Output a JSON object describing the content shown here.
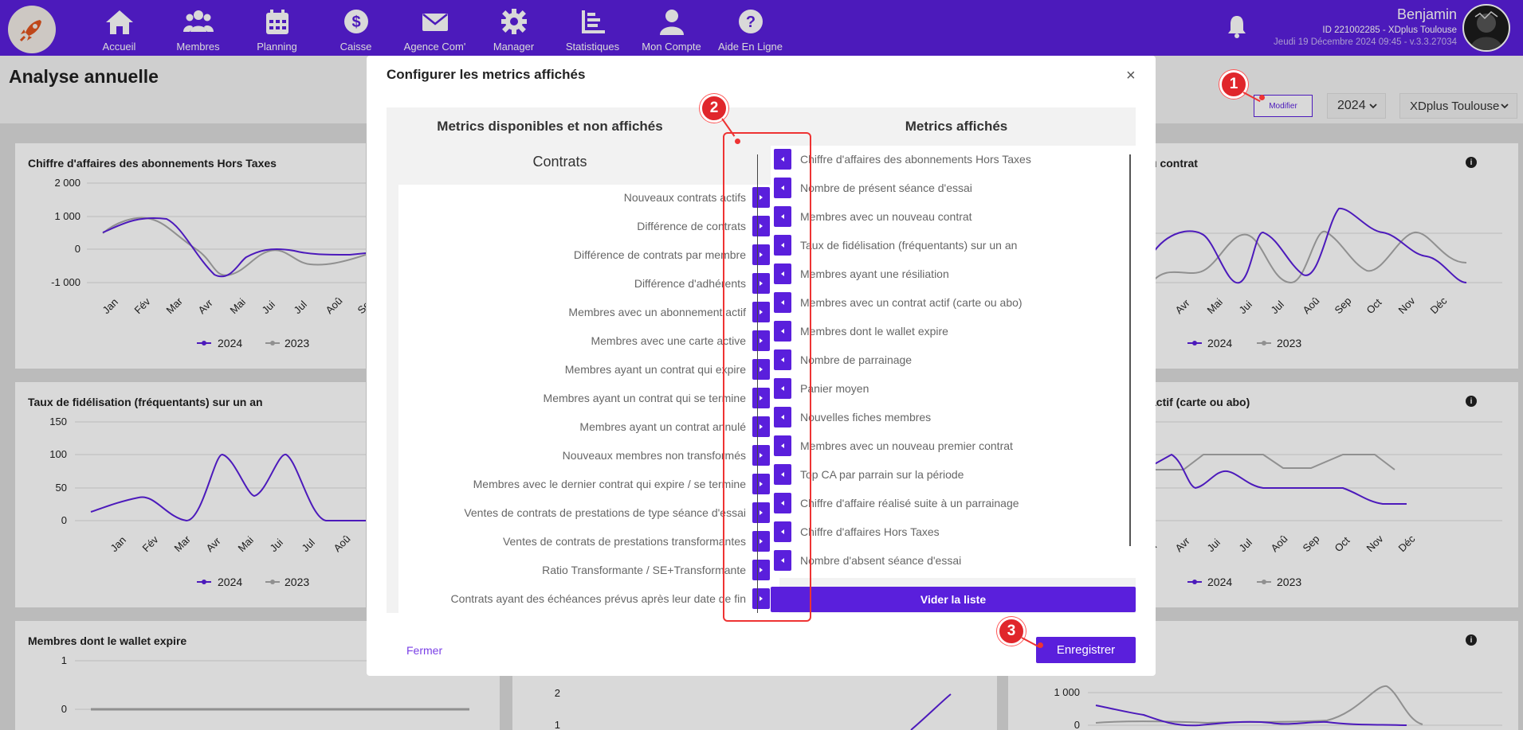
{
  "nav": {
    "items": [
      {
        "label": "Accueil",
        "icon": "home-icon"
      },
      {
        "label": "Membres",
        "icon": "members-icon"
      },
      {
        "label": "Planning",
        "icon": "calendar-icon"
      },
      {
        "label": "Caisse",
        "icon": "dollar-icon"
      },
      {
        "label": "Agence Com'",
        "icon": "envelope-icon"
      },
      {
        "label": "Manager",
        "icon": "gear-icon"
      },
      {
        "label": "Statistiques",
        "icon": "chart-icon"
      },
      {
        "label": "Mon Compte",
        "icon": "user-icon"
      },
      {
        "label": "Aide En Ligne",
        "icon": "help-icon"
      }
    ]
  },
  "user": {
    "name": "Benjamin",
    "id": "ID 221002285 - XDplus Toulouse",
    "date": "Jeudi 19 Décembre 2024 09:45 - v.3.3.27034"
  },
  "page": {
    "title": "Analyse annuelle",
    "modifier_label": "Modifier",
    "year": "2024",
    "club": "XDplus Toulouse"
  },
  "background_cards": {
    "c1_title": "Chiffre d'affaires des abonnements Hors Taxes",
    "c1_y": [
      "2 000",
      "1 000",
      "0",
      "-1 000"
    ],
    "c2_title": "u contrat",
    "c3_title": "Taux de fidélisation (fréquentants) sur un an",
    "c3_y": [
      "150",
      "100",
      "50",
      "0"
    ],
    "c4_title": "actif (carte ou abo)",
    "c5_title": "Membres dont le wallet expire",
    "c5_y": [
      "1",
      "0"
    ],
    "c6_y": [
      "2",
      "1"
    ],
    "c7_y": [
      "1 000",
      "0"
    ],
    "months_left": [
      "Jan",
      "Fév",
      "Mar",
      "Avr",
      "Mai",
      "Jui",
      "Jul",
      "Aoû",
      "Se"
    ],
    "months_right": [
      "Avr",
      "Mai",
      "Jui",
      "Jul",
      "Aoû",
      "Sep",
      "Oct",
      "Nov",
      "Déc"
    ],
    "months_right2": [
      "ar",
      "Avr",
      "Jui",
      "Jul",
      "Aoû",
      "Sep",
      "Oct",
      "Nov",
      "Déc"
    ],
    "legend_2024": "2024",
    "legend_2023": "2023",
    "colors": {
      "series_2024": "#5a1fdc",
      "series_2023": "#aaaaaa"
    }
  },
  "modal": {
    "title": "Configurer les metrics affichés",
    "close": "×",
    "left_header": "Metrics disponibles et non affichés",
    "right_header": "Metrics affichés",
    "group": "Contrats",
    "available": [
      "Nouveaux contrats actifs",
      "Différence de contrats",
      "Différence de contrats par membre",
      "Différence d'adhérents",
      "Membres avec un abonnement actif",
      "Membres avec une carte active",
      "Membres ayant un contrat qui expire",
      "Membres ayant un contrat qui se termine",
      "Membres ayant un contrat annulé",
      "Nouveaux membres non transformés",
      "Membres avec le dernier contrat qui expire / se termine",
      "Ventes de contrats de prestations de type séance d'essai",
      "Ventes de contrats de prestations transformantes",
      "Ratio Transformante / SE+Transformante",
      "Contrats ayant des échéances prévus après leur date de fin"
    ],
    "displayed": [
      "Chiffre d'affaires des abonnements Hors Taxes",
      "Nombre de présent séance d'essai",
      "Membres avec un nouveau contrat",
      "Taux de fidélisation (fréquentants) sur un an",
      "Membres ayant une résiliation",
      "Membres avec un contrat actif (carte ou abo)",
      "Membres dont le wallet expire",
      "Nombre de parrainage",
      "Panier moyen",
      "Nouvelles fiches membres",
      "Membres avec un nouveau premier contrat",
      "Top CA par parrain sur la période",
      "Chiffre d'affaire réalisé suite à un parrainage",
      "Chiffre d'affaires Hors Taxes",
      "Nombre d'absent séance d'essai"
    ],
    "clear_label": "Vider la liste",
    "close_label": "Fermer",
    "save_label": "Enregistrer"
  },
  "annotations": [
    "1",
    "2",
    "3"
  ],
  "colors": {
    "brand": "#5a1fdc",
    "annotation": "#e0262b"
  }
}
